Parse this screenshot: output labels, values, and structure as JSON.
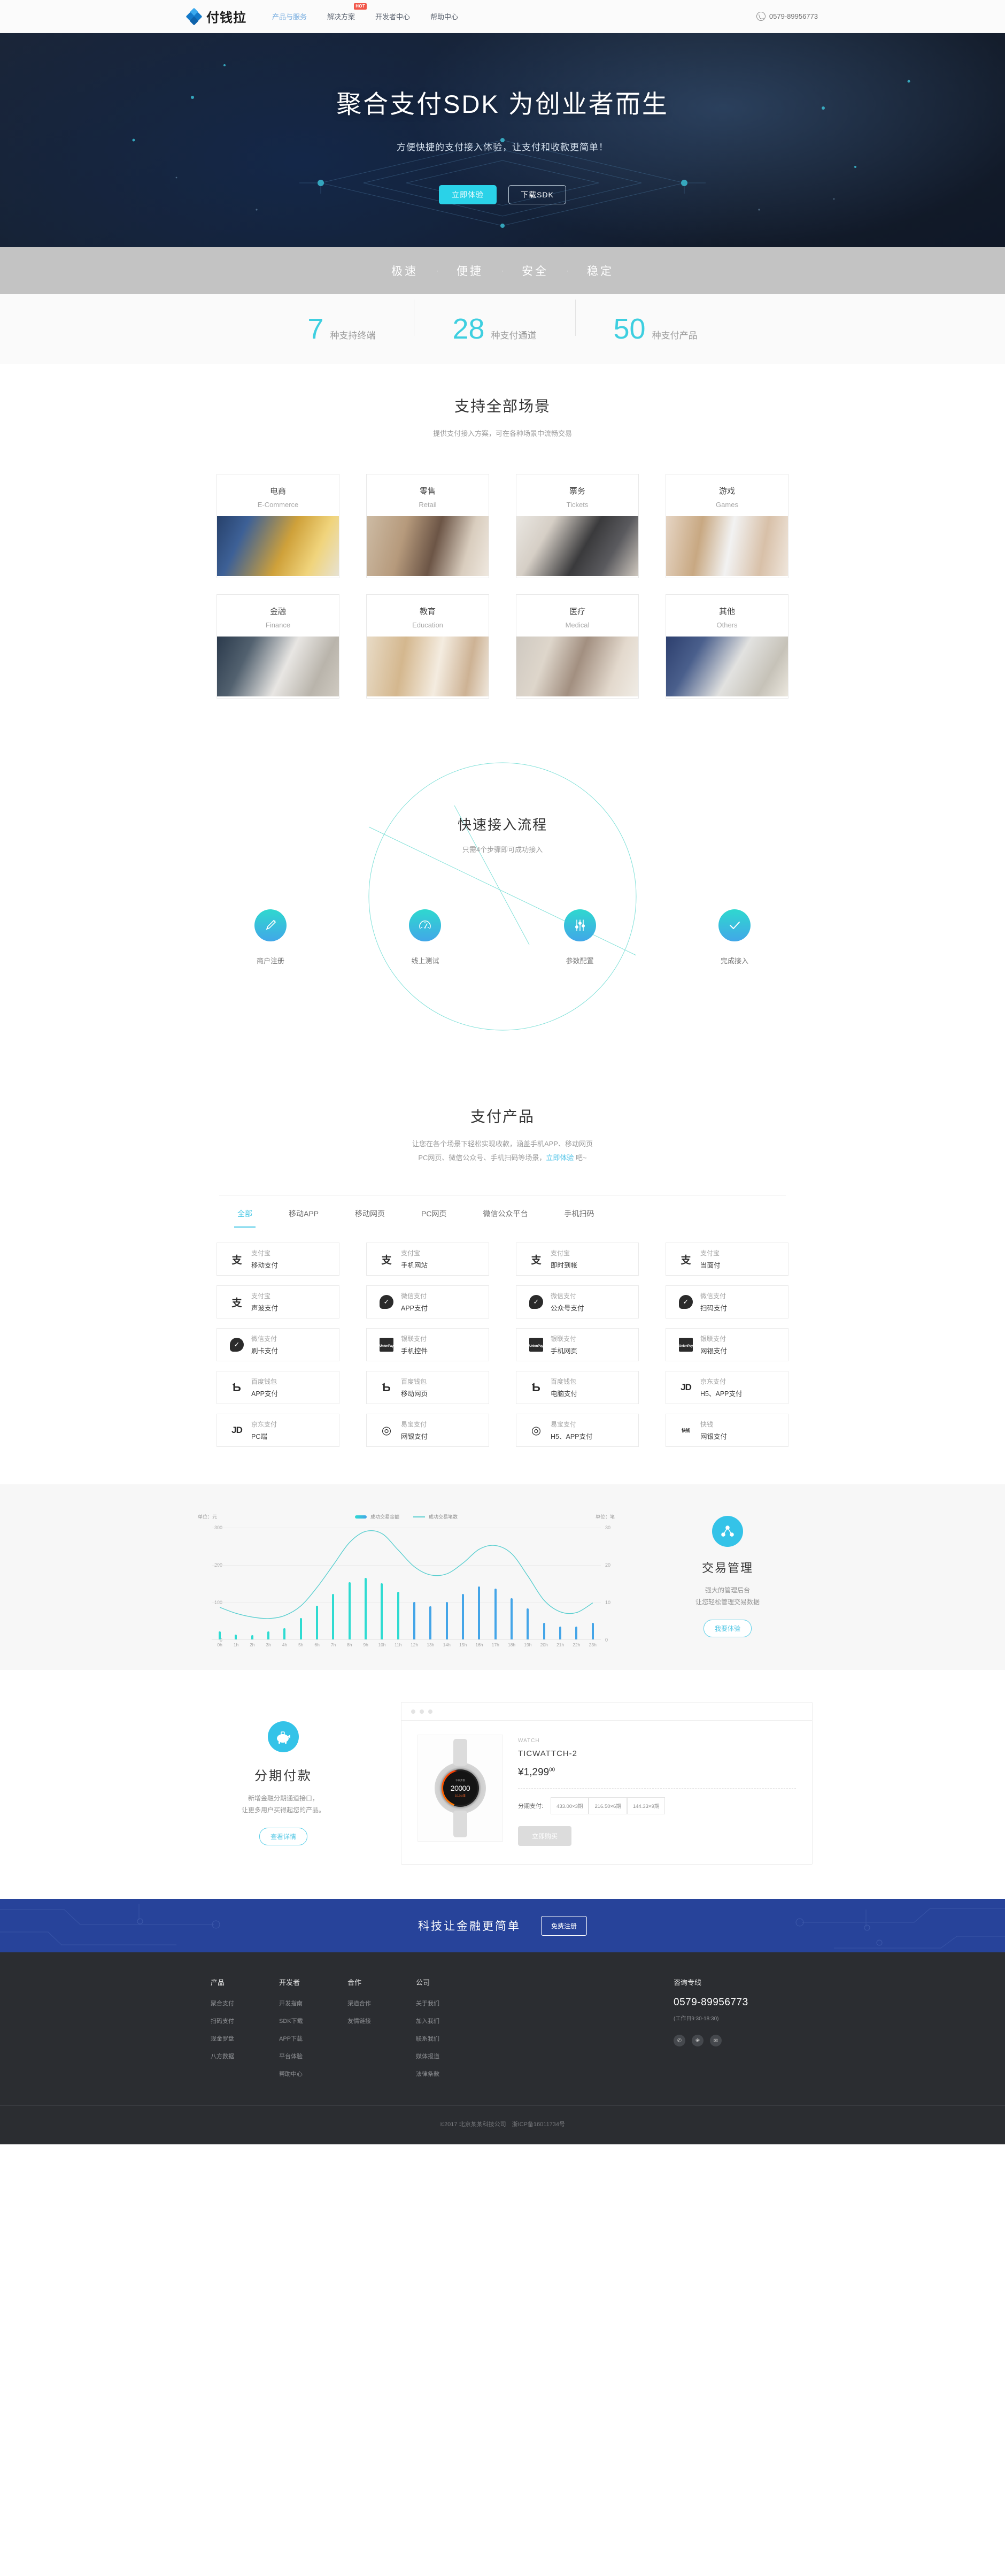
{
  "header": {
    "logo_text": "付钱拉",
    "nav": [
      {
        "label": "产品与服务",
        "active": true,
        "badge": ""
      },
      {
        "label": "解决方案",
        "active": false,
        "badge": "HOT"
      },
      {
        "label": "开发者中心",
        "active": false,
        "badge": ""
      },
      {
        "label": "帮助中心",
        "active": false,
        "badge": ""
      }
    ],
    "phone": "0579-89956773"
  },
  "hero": {
    "title": "聚合支付SDK 为创业者而生",
    "subtitle": "方便快捷的支付接入体验，让支付和收款更简单！",
    "btn_primary": "立即体验",
    "btn_secondary": "下载SDK"
  },
  "features": {
    "items": [
      "极速",
      "便捷",
      "安全",
      "稳定"
    ],
    "separator": "·"
  },
  "stats": [
    {
      "num": "7",
      "label": "种支持终端"
    },
    {
      "num": "28",
      "label": "种支付通道"
    },
    {
      "num": "50",
      "label": "种支付产品"
    }
  ],
  "scenes": {
    "title": "支持全部场景",
    "desc": "提供支付接入方案，可在各种场景中流畅交易",
    "cards": [
      {
        "cn": "电商",
        "en": "E-Commerce",
        "img": "si-ecom"
      },
      {
        "cn": "零售",
        "en": "Retail",
        "img": "si-retail"
      },
      {
        "cn": "票务",
        "en": "Tickets",
        "img": "si-ticket"
      },
      {
        "cn": "游戏",
        "en": "Games",
        "img": "si-games"
      },
      {
        "cn": "金融",
        "en": "Finance",
        "img": "si-fin"
      },
      {
        "cn": "教育",
        "en": "Education",
        "img": "si-edu"
      },
      {
        "cn": "医疗",
        "en": "Medical",
        "img": "si-med"
      },
      {
        "cn": "其他",
        "en": "Others",
        "img": "si-other"
      }
    ]
  },
  "process": {
    "title": "快速接入流程",
    "desc": "只需4个步骤即可成功接入",
    "steps": [
      {
        "label": "商户注册",
        "icon": "pen-icon"
      },
      {
        "label": "线上测试",
        "icon": "gauge-icon"
      },
      {
        "label": "参数配置",
        "icon": "sliders-icon"
      },
      {
        "label": "完成接入",
        "icon": "check-icon"
      }
    ]
  },
  "products": {
    "title": "支付产品",
    "desc_line1": "让您在各个场景下轻松实现收款，涵盖手机APP、移动网页",
    "desc_line2_pre": "PC网页、微信公众号、手机扫码等场景，",
    "desc_link": "立即体验",
    "desc_line2_post": " 吧~",
    "tabs": [
      {
        "label": "全部",
        "active": true
      },
      {
        "label": "移动APP",
        "active": false
      },
      {
        "label": "移动网页",
        "active": false
      },
      {
        "label": "PC网页",
        "active": false
      },
      {
        "label": "微信公众平台",
        "active": false
      },
      {
        "label": "手机扫码",
        "active": false
      }
    ],
    "items": [
      {
        "brand": "支付宝",
        "name": "移动支付",
        "logo": "alipay"
      },
      {
        "brand": "支付宝",
        "name": "手机网站",
        "logo": "alipay"
      },
      {
        "brand": "支付宝",
        "name": "即时到帐",
        "logo": "alipay"
      },
      {
        "brand": "支付宝",
        "name": "当面付",
        "logo": "alipay"
      },
      {
        "brand": "支付宝",
        "name": "声波支付",
        "logo": "alipay"
      },
      {
        "brand": "微信支付",
        "name": "APP支付",
        "logo": "wechat"
      },
      {
        "brand": "微信支付",
        "name": "公众号支付",
        "logo": "wechat"
      },
      {
        "brand": "微信支付",
        "name": "扫码支付",
        "logo": "wechat"
      },
      {
        "brand": "微信支付",
        "name": "刷卡支付",
        "logo": "wechat"
      },
      {
        "brand": "银联支付",
        "name": "手机控件",
        "logo": "unionpay"
      },
      {
        "brand": "银联支付",
        "name": "手机网页",
        "logo": "unionpay"
      },
      {
        "brand": "银联支付",
        "name": "网银支付",
        "logo": "unionpay"
      },
      {
        "brand": "百度钱包",
        "name": "APP支付",
        "logo": "baidu"
      },
      {
        "brand": "百度钱包",
        "name": "移动网页",
        "logo": "baidu"
      },
      {
        "brand": "百度钱包",
        "name": "电脑支付",
        "logo": "baidu"
      },
      {
        "brand": "京东支付",
        "name": "H5、APP支付",
        "logo": "jd"
      },
      {
        "brand": "京东支付",
        "name": "PC端",
        "logo": "jd"
      },
      {
        "brand": "易宝支付",
        "name": "网银支付",
        "logo": "yeepay"
      },
      {
        "brand": "易宝支付",
        "name": "H5、APP支付",
        "logo": "yeepay"
      },
      {
        "brand": "快钱",
        "name": "网银支付",
        "logo": "kuaiqian"
      }
    ]
  },
  "chart_data": {
    "type": "bar",
    "title": "",
    "unit_left": "单位：元",
    "unit_right": "单位：笔",
    "categories": [
      "0h",
      "1h",
      "2h",
      "3h",
      "4h",
      "5h",
      "6h",
      "7h",
      "8h",
      "9h",
      "10h",
      "11h",
      "12h",
      "13h",
      "14h",
      "15h",
      "16h",
      "17h",
      "18h",
      "19h",
      "20h",
      "21h",
      "22h",
      "23h"
    ],
    "series": [
      {
        "name": "成功交易金额",
        "type": "bar",
        "axis": "left",
        "values": [
          22,
          13,
          11,
          22,
          30,
          58,
          90,
          122,
          153,
          165,
          151,
          128,
          100,
          89,
          100,
          122,
          142,
          137,
          110,
          83,
          45,
          34,
          34,
          45
        ]
      },
      {
        "name": "成功交易笔数",
        "type": "line",
        "axis": "right",
        "values": [
          8.6,
          7.0,
          6.0,
          5.6,
          6.4,
          9.0,
          14.0,
          20.0,
          26.0,
          29.0,
          28.4,
          24.0,
          19.5,
          17.3,
          17.6,
          20.5,
          24.2,
          25.2,
          23.0,
          17.0,
          10.5,
          7.4,
          7.2,
          9.8
        ]
      }
    ],
    "ylim_left": [
      0,
      300
    ],
    "ylim_right": [
      0,
      30
    ],
    "yticks_left": [
      "0",
      "100",
      "200",
      "300"
    ],
    "yticks_right": [
      "0",
      "10",
      "20",
      "30"
    ],
    "xlabel": "",
    "ylabel": "",
    "grid": true,
    "legend_position": "top-center",
    "colors": {
      "bar_start": "#2fdbd1",
      "bar_end": "#44a5e8",
      "line": "#5ccfd0"
    }
  },
  "trade": {
    "title": "交易管理",
    "p1": "强大的管理后台",
    "p2": "让您轻松管理交易数据",
    "btn": "我要体验",
    "icon": "network-node-icon"
  },
  "installment": {
    "title": "分期付款",
    "p1": "新增金融分期通道接口，",
    "p2": "让更多用户买得起您的产品。",
    "btn": "查看详情",
    "icon": "piggy-bank-icon",
    "demo": {
      "category": "WATCH",
      "name": "TICWATTCH-2",
      "price_main": "¥1,299",
      "price_cents": "00",
      "inst_label": "分期支付:",
      "inst_options": [
        "433.00×3期",
        "216.50×6期",
        "144.33×9期"
      ],
      "buy_btn": "立即购买",
      "watch_top": "今日步数",
      "watch_num": "20000",
      "watch_sub": "10.2公里"
    }
  },
  "cta": {
    "title": "科技让金融更简单",
    "btn": "免费注册"
  },
  "footer": {
    "columns": [
      {
        "title": "产品",
        "links": [
          "聚合支付",
          "扫码支付",
          "现金罗盘",
          "八方数据"
        ]
      },
      {
        "title": "开发者",
        "links": [
          "开发指南",
          "SDK下载",
          "APP下载",
          "平台体验",
          "帮助中心"
        ]
      },
      {
        "title": "合作",
        "links": [
          "渠道合作",
          "友情链接"
        ]
      },
      {
        "title": "公司",
        "links": [
          "关于我们",
          "加入我们",
          "联系我们",
          "媒体报道",
          "法律条款"
        ]
      }
    ],
    "contact": {
      "title": "咨询专线",
      "phone": "0579-89956773",
      "hours": "(工作日9:30-18:30)",
      "social": [
        "wechat-icon",
        "weibo-icon",
        "email-icon"
      ]
    },
    "copyright": "©2017 北京某某科技公司　浙ICP备16011734号"
  }
}
